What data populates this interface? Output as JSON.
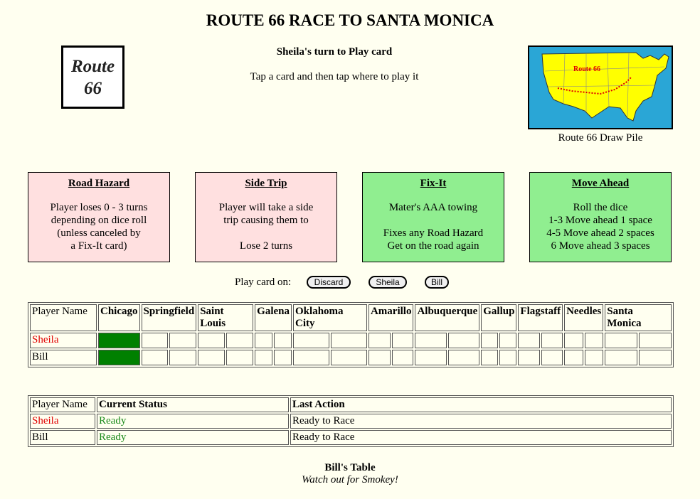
{
  "page": {
    "title": "ROUTE 66 RACE TO SANTA MONICA",
    "logo_lines": [
      "Route",
      "66"
    ],
    "turn_text": "Sheila's turn to Play card",
    "instructions": "Tap a card and then tap where to play it",
    "map_label": "Route 66",
    "draw_pile_label": "Route 66 Draw Pile"
  },
  "cards": [
    {
      "title": "Road Hazard",
      "color": "#ffe0e0",
      "lines": [
        "Player loses 0 - 3 turns",
        "depending on dice roll",
        "(unless canceled by",
        "a Fix-It card)"
      ]
    },
    {
      "title": "Side Trip",
      "color": "#ffe0e0",
      "lines": [
        "Player will take a side",
        "trip causing them to",
        "",
        "Lose 2 turns"
      ]
    },
    {
      "title": "Fix-It",
      "color": "#90ee90",
      "lines": [
        "Mater's AAA towing",
        "",
        "Fixes any Road Hazard",
        "Get on the road again"
      ]
    },
    {
      "title": "Move Ahead",
      "color": "#90ee90",
      "lines": [
        "Roll the dice",
        "1-3 Move ahead 1 space",
        "4-5 Move ahead 2 spaces",
        "6 Move ahead 3 spaces"
      ]
    }
  ],
  "play": {
    "label": "Play card on:",
    "buttons": [
      "Discard",
      "Sheila",
      "Bill"
    ]
  },
  "board": {
    "header_player": "Player Name",
    "cities": [
      "Chicago",
      "Springfield",
      "Saint Louis",
      "Galena",
      "Oklahoma City",
      "Amarillo",
      "Albuquerque",
      "Gallup",
      "Flagstaff",
      "Needles",
      "Santa Monica"
    ],
    "players": [
      {
        "name": "Sheila",
        "name_color": "#e00000",
        "position_city": "Chicago"
      },
      {
        "name": "Bill",
        "name_color": "#000000",
        "position_city": "Chicago"
      }
    ]
  },
  "status_table": {
    "headers": [
      "Player Name",
      "Current Status",
      "Last Action"
    ],
    "rows": [
      {
        "name": "Sheila",
        "status": "Ready",
        "action": "Ready to Race"
      },
      {
        "name": "Bill",
        "status": "Ready",
        "action": "Ready to Race"
      }
    ]
  },
  "footer": {
    "table_name": "Bill's Table",
    "tagline": "Watch out for Smokey!"
  },
  "colors": {
    "background": "#fffff0",
    "hazard_card": "#ffe0e0",
    "good_card": "#90ee90",
    "player_marker": "#008000",
    "active_player": "#e00000",
    "ready_status": "#1a8a1a"
  }
}
